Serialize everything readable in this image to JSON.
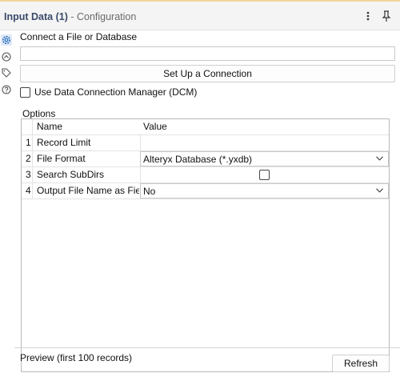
{
  "header": {
    "title": "Input Data (1)",
    "subtitle": " - Configuration"
  },
  "sidebar": {
    "icons": [
      "gear-icon",
      "annotation-icon",
      "tag-icon",
      "help-icon"
    ],
    "selected": "gear-icon"
  },
  "connect": {
    "label": "Connect a File or Database",
    "input_value": "",
    "setup_button": "Set Up a Connection"
  },
  "dcm": {
    "label": "Use Data Connection Manager (DCM)",
    "checked": false
  },
  "options": {
    "label": "Options",
    "columns": [
      "Name",
      "Value"
    ],
    "rows": [
      {
        "num": "1",
        "name": "Record Limit",
        "value": ""
      },
      {
        "num": "2",
        "name": "File Format",
        "value": "Alteryx Database (*.yxdb)"
      },
      {
        "num": "3",
        "name": "Search SubDirs",
        "value": ""
      },
      {
        "num": "4",
        "name": "Output File Name as Field",
        "value": "No"
      }
    ]
  },
  "preview": {
    "label": "Preview (first 100 records)",
    "refresh_button": "Refresh"
  },
  "colors": {
    "accent_top": "#f2d49a",
    "header_bg": "#f4f4f4",
    "title": "#3a4a6a",
    "selected_icon_bg": "#dfe9f7"
  }
}
